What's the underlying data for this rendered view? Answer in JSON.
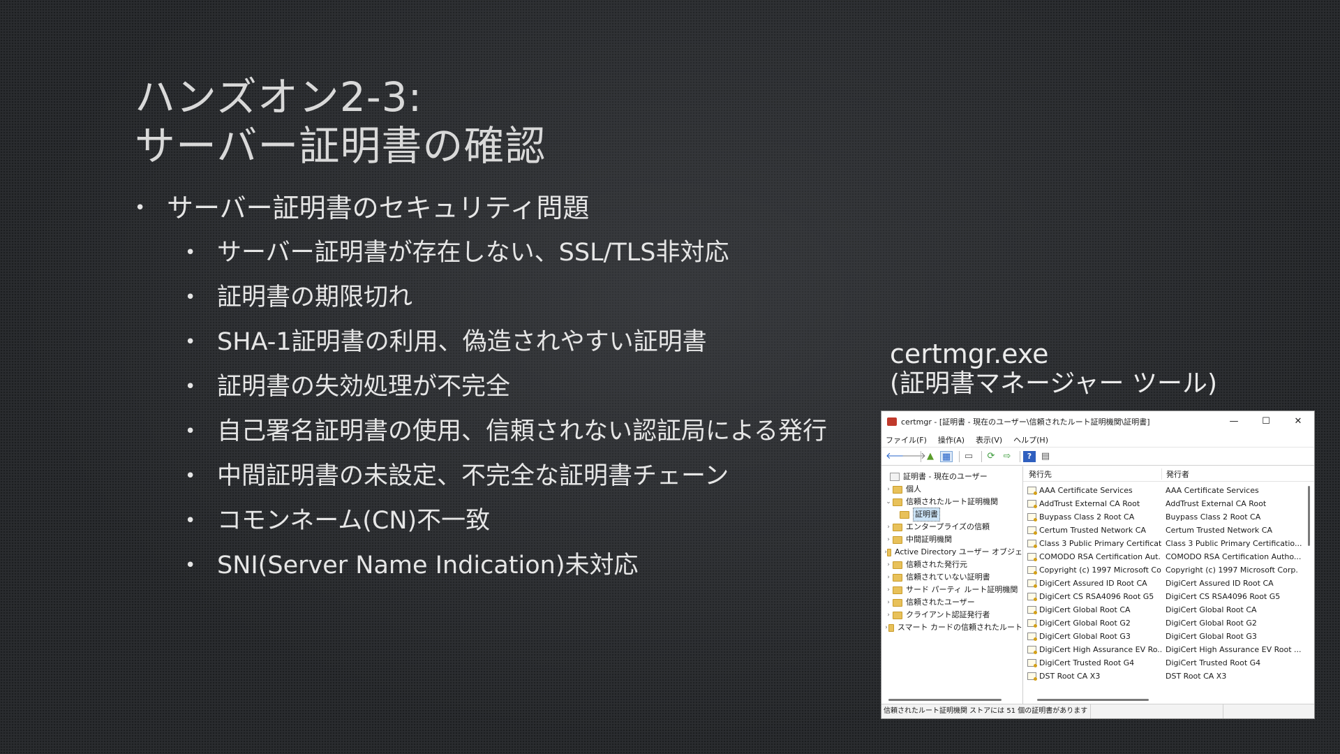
{
  "title": {
    "line1": "ハンズオン2-3:",
    "line2": "サーバー証明書の確認"
  },
  "bullets": [
    {
      "level": 1,
      "text": "サーバー証明書のセキュリティ問題"
    },
    {
      "level": 2,
      "text": "サーバー証明書が存在しない、SSL/TLS非対応"
    },
    {
      "level": 2,
      "text": "証明書の期限切れ"
    },
    {
      "level": 2,
      "text": "SHA-1証明書の利用、偽造されやすい証明書"
    },
    {
      "level": 2,
      "text": "証明書の失効処理が不完全"
    },
    {
      "level": 2,
      "text": "自己署名証明書の使用、信頼されない認証局による発行"
    },
    {
      "level": 2,
      "text": "中間証明書の未設定、不完全な証明書チェーン"
    },
    {
      "level": 2,
      "text": "コモンネーム(CN)不一致"
    },
    {
      "level": 2,
      "text": "SNI(Server Name Indication)未対応"
    }
  ],
  "bullet_glyph": "•",
  "caption": {
    "line1": "certmgr.exe",
    "line2": "(証明書マネージャー ツール)"
  },
  "window": {
    "title": "certmgr - [証明書 - 現在のユーザー\\信頼されたルート証明機関\\証明書]",
    "controls": {
      "minimize": "—",
      "maximize": "☐",
      "close": "✕"
    },
    "menu": [
      "ファイル(F)",
      "操作(A)",
      "表示(V)",
      "ヘルプ(H)"
    ],
    "toolbar_icons": {
      "back": "🡐",
      "forward": "🡒",
      "up": "▲",
      "props": "▦",
      "copy": "▭",
      "refresh": "⟳",
      "export": "⇨",
      "help": "?",
      "view": "▤"
    },
    "tree": {
      "root": "証明書 - 現在のユーザー",
      "items": [
        {
          "label": "個人",
          "expander": "›",
          "indent": 1,
          "selected": false
        },
        {
          "label": "信頼されたルート証明機関",
          "expander": "⌄",
          "indent": 1,
          "selected": false
        },
        {
          "label": "証明書",
          "expander": "",
          "indent": 2,
          "selected": true
        },
        {
          "label": "エンタープライズの信頼",
          "expander": "›",
          "indent": 1,
          "selected": false
        },
        {
          "label": "中間証明機関",
          "expander": "›",
          "indent": 1,
          "selected": false
        },
        {
          "label": "Active Directory ユーザー オブジェ",
          "expander": "›",
          "indent": 1,
          "selected": false
        },
        {
          "label": "信頼された発行元",
          "expander": "›",
          "indent": 1,
          "selected": false
        },
        {
          "label": "信頼されていない証明書",
          "expander": "›",
          "indent": 1,
          "selected": false
        },
        {
          "label": "サード パーティ ルート証明機関",
          "expander": "›",
          "indent": 1,
          "selected": false
        },
        {
          "label": "信頼されたユーザー",
          "expander": "›",
          "indent": 1,
          "selected": false
        },
        {
          "label": "クライアント認証発行者",
          "expander": "›",
          "indent": 1,
          "selected": false
        },
        {
          "label": "スマート カードの信頼されたルート",
          "expander": "›",
          "indent": 1,
          "selected": false
        }
      ]
    },
    "list": {
      "columns": [
        "発行先",
        "発行者"
      ],
      "sort_arrow": "˄",
      "rows": [
        [
          "AAA Certificate Services",
          "AAA Certificate Services"
        ],
        [
          "AddTrust External CA Root",
          "AddTrust External CA Root"
        ],
        [
          "Buypass Class 2 Root CA",
          "Buypass Class 2 Root CA"
        ],
        [
          "Certum Trusted Network CA",
          "Certum Trusted Network CA"
        ],
        [
          "Class 3 Public Primary Certificati...",
          "Class 3 Public Primary Certificatio..."
        ],
        [
          "COMODO RSA Certification Aut...",
          "COMODO RSA Certification Autho..."
        ],
        [
          "Copyright (c) 1997 Microsoft Co...",
          "Copyright (c) 1997 Microsoft Corp."
        ],
        [
          "DigiCert Assured ID Root CA",
          "DigiCert Assured ID Root CA"
        ],
        [
          "DigiCert CS RSA4096 Root G5",
          "DigiCert CS RSA4096 Root G5"
        ],
        [
          "DigiCert Global Root CA",
          "DigiCert Global Root CA"
        ],
        [
          "DigiCert Global Root G2",
          "DigiCert Global Root G2"
        ],
        [
          "DigiCert Global Root G3",
          "DigiCert Global Root G3"
        ],
        [
          "DigiCert High Assurance EV Ro...",
          "DigiCert High Assurance EV Root ..."
        ],
        [
          "DigiCert Trusted Root G4",
          "DigiCert Trusted Root G4"
        ],
        [
          "DST Root CA X3",
          "DST Root CA X3"
        ]
      ]
    },
    "status": "信頼されたルート証明機関 ストアには 51 個の証明書があります"
  }
}
